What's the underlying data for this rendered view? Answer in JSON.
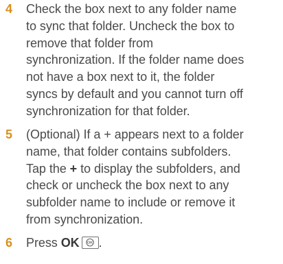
{
  "steps": [
    {
      "number": "4",
      "lines": [
        "Check the box next to any folder name",
        "to sync that folder. Uncheck the box to",
        "remove that folder from",
        "synchronization. If the folder name does",
        "not have a box next to it, the folder",
        "syncs by default and you cannot turn off",
        "synchronization for that folder."
      ]
    },
    {
      "number": "5",
      "line1": "(Optional) If a + appears next to a folder",
      "line2": "name, that folder contains subfolders.",
      "line3_pre": "Tap the ",
      "line3_bold": "+",
      "line3_post": " to display the subfolders, and",
      "line4": "check or uncheck the box next to any",
      "line5": "subfolder name to include or remove it",
      "line6": "from synchronization."
    },
    {
      "number": "6",
      "pre": "Press ",
      "bold": "OK",
      "key_icon": "ok-key-icon",
      "post": "."
    }
  ]
}
